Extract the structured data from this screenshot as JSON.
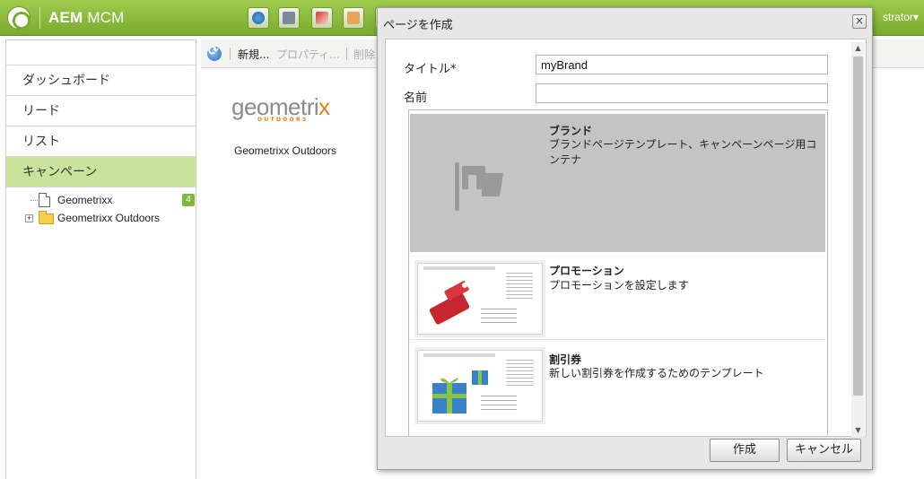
{
  "app": {
    "title_bold": "AEM",
    "title_rest": " MCM",
    "user_menu": "strator▾"
  },
  "top_icons": [
    "globe-icon",
    "camera-icon",
    "megaphone-icon",
    "mail-icon",
    "app-icon",
    "app-icon",
    "app-icon"
  ],
  "sidebar": {
    "items": [
      {
        "label": "ダッシュボード"
      },
      {
        "label": "リード"
      },
      {
        "label": "リスト"
      },
      {
        "label": "キャンペーン",
        "active": true
      }
    ],
    "tree": [
      {
        "label": "Geometrixx",
        "badge": "4",
        "type": "file"
      },
      {
        "label": "Geometrixx Outdoors",
        "type": "folder"
      }
    ]
  },
  "toolbar": {
    "new_label": "新規...",
    "properties_label": "プロパティ...",
    "delete_label": "削除"
  },
  "content": {
    "logo_text_a": "geometri",
    "logo_text_b": "x",
    "logo_sub": "OUTDOORS",
    "caption": "Geometrixx Outdoors"
  },
  "dialog": {
    "title": "ページを作成",
    "title_label": "タイトル*",
    "title_value": "myBrand",
    "name_label": "名前",
    "name_value": "",
    "templates": [
      {
        "name": "ブランド",
        "desc": "ブランドページテンプレート、キャンペーンページ用コンテナ",
        "selected": true
      },
      {
        "name": "プロモーション",
        "desc": "プロモーションを設定します",
        "thumb_title": "Q4 Financial Resuf",
        "thumb_text": "condimentum ipsum et orci. Aenean est. Duis eget diam. Phasellus vitae magna. Sed dictum.",
        "thumb_badge": "SALE"
      },
      {
        "name": "割引券",
        "desc": "新しい割引券を作成するためのテンプレート",
        "thumb_title": "Q4 Financial Resuf",
        "thumb_text": "condimentum ipsum et orci. Aenean est. Duis eget diam. Phasellus vitae magna. Sed dictum."
      }
    ],
    "create_button": "作成",
    "cancel_button": "キャンセル",
    "close_glyph": "×",
    "scroll_up_glyph": "▲",
    "scroll_down_glyph": "▼"
  },
  "colors": {
    "brand_green": "#8bbd3c",
    "active_nav": "#c9e49a",
    "badge_green": "#7eb93c",
    "logo_orange": "#e37f1b"
  }
}
